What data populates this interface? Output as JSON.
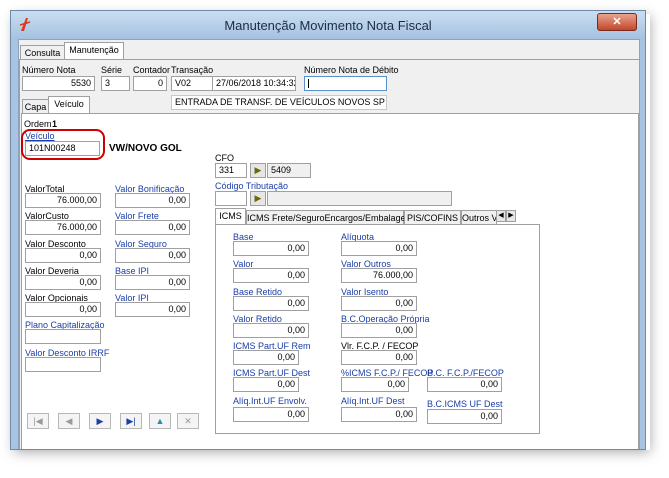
{
  "window": {
    "title": "Manutenção Movimento Nota Fiscal",
    "close_glyph": "✕"
  },
  "top_tabs": [
    "Consulta",
    "Manutenção"
  ],
  "header": {
    "numero_nota": {
      "label": "Número Nota",
      "value": "5530"
    },
    "serie": {
      "label": "Série",
      "value": "3"
    },
    "contador": {
      "label": "Contador",
      "value": "0"
    },
    "transacao": {
      "label": "Transação",
      "value": "V02",
      "datetime": "27/06/2018 10:34:32",
      "description": "ENTRADA DE TRANSF. DE VEÍCULOS NOVOS SP"
    },
    "numero_nota_debito": {
      "label": "Número Nota de Débito",
      "value": ""
    }
  },
  "sub_tabs": [
    "Capa",
    "Veículo"
  ],
  "ordem": {
    "label": "Ordem",
    "value": "1"
  },
  "veiculo": {
    "label": "Veículo",
    "value": "101N00248",
    "description": "VW/NOVO GOL"
  },
  "values": {
    "valor_total": {
      "label": "ValorTotal",
      "value": "76.000,00"
    },
    "valor_bonificacao": {
      "label": "Valor Bonificação",
      "value": "0,00"
    },
    "valor_custo": {
      "label": "ValorCusto",
      "value": "76.000,00"
    },
    "valor_frete": {
      "label": "Valor Frete",
      "value": "0,00"
    },
    "valor_desconto": {
      "label": "Valor Desconto",
      "value": "0,00"
    },
    "valor_seguro": {
      "label": "Valor Seguro",
      "value": "0,00"
    },
    "valor_deveria": {
      "label": "Valor Deveria",
      "value": "0,00"
    },
    "base_ipi": {
      "label": "Base IPI",
      "value": "0,00"
    },
    "valor_opcionais": {
      "label": "Valor Opcionais",
      "value": "0,00"
    },
    "valor_ipi": {
      "label": "Valor IPI",
      "value": "0,00"
    },
    "plano_capitalizacao": {
      "label": "Plano Capitalização",
      "value": ""
    },
    "valor_desconto_irrf": {
      "label": "Valor Desconto IRRF",
      "value": ""
    }
  },
  "cfo": {
    "label": "CFO",
    "value": "331",
    "code": "5409"
  },
  "codigo_tributacao": {
    "label": "Código Tributação",
    "value": ""
  },
  "tax_tabs": [
    "ICMS",
    "ICMS Frete/SeguroEncargos/Embalagem",
    "PIS/COFINS",
    "Outros V"
  ],
  "icms": {
    "base": {
      "label": "Base",
      "value": "0,00"
    },
    "aliquota": {
      "label": "Alíquota",
      "value": "0,00"
    },
    "valor": {
      "label": "Valor",
      "value": "0,00"
    },
    "valor_outros": {
      "label": "Valor Outros",
      "value": "76.000,00"
    },
    "base_retido": {
      "label": "Base Retido",
      "value": "0,00"
    },
    "valor_isento": {
      "label": "Valor Isento",
      "value": "0,00"
    },
    "valor_retido": {
      "label": "Valor Retido",
      "value": "0,00"
    },
    "bc_operacao_propria": {
      "label": "B.C.Operação Própria",
      "value": "0,00"
    },
    "icms_part_uf_rem": {
      "label": "ICMS Part.UF Rem",
      "value": "0,00"
    },
    "vlr_fcp_fecop": {
      "label": "Vlr. F.C.P. / FECOP",
      "value": "0,00"
    },
    "icms_part_uf_dest": {
      "label": "ICMS Part.UF Dest",
      "value": "0,00"
    },
    "pct_icms_fcp_fecop": {
      "label": "%ICMS F.C.P./ FECOP",
      "value": "0,00"
    },
    "bc_fcp_fecop": {
      "label": "B.C. F.C.P./FECOP",
      "value": "0,00"
    },
    "aliq_int_uf_envolv": {
      "label": "Alíq.Int.UF Envolv.",
      "value": "0,00"
    },
    "aliq_int_uf_dest": {
      "label": "Alíq.Int.UF Dest",
      "value": "0,00"
    },
    "bc_icms_uf_dest": {
      "label": "B.C.ICMS UF Dest",
      "value": "0,00"
    }
  },
  "nav": {
    "first": "|◀",
    "prev": "◀",
    "next": "▶",
    "last": "▶|",
    "up": "▲",
    "delete": "✕"
  },
  "colors": {
    "title_bar": "#a6c2e0",
    "client_bg": "#f0f0f0",
    "label_blue": "#1a3ea8",
    "highlight_red": "#cc0000"
  }
}
